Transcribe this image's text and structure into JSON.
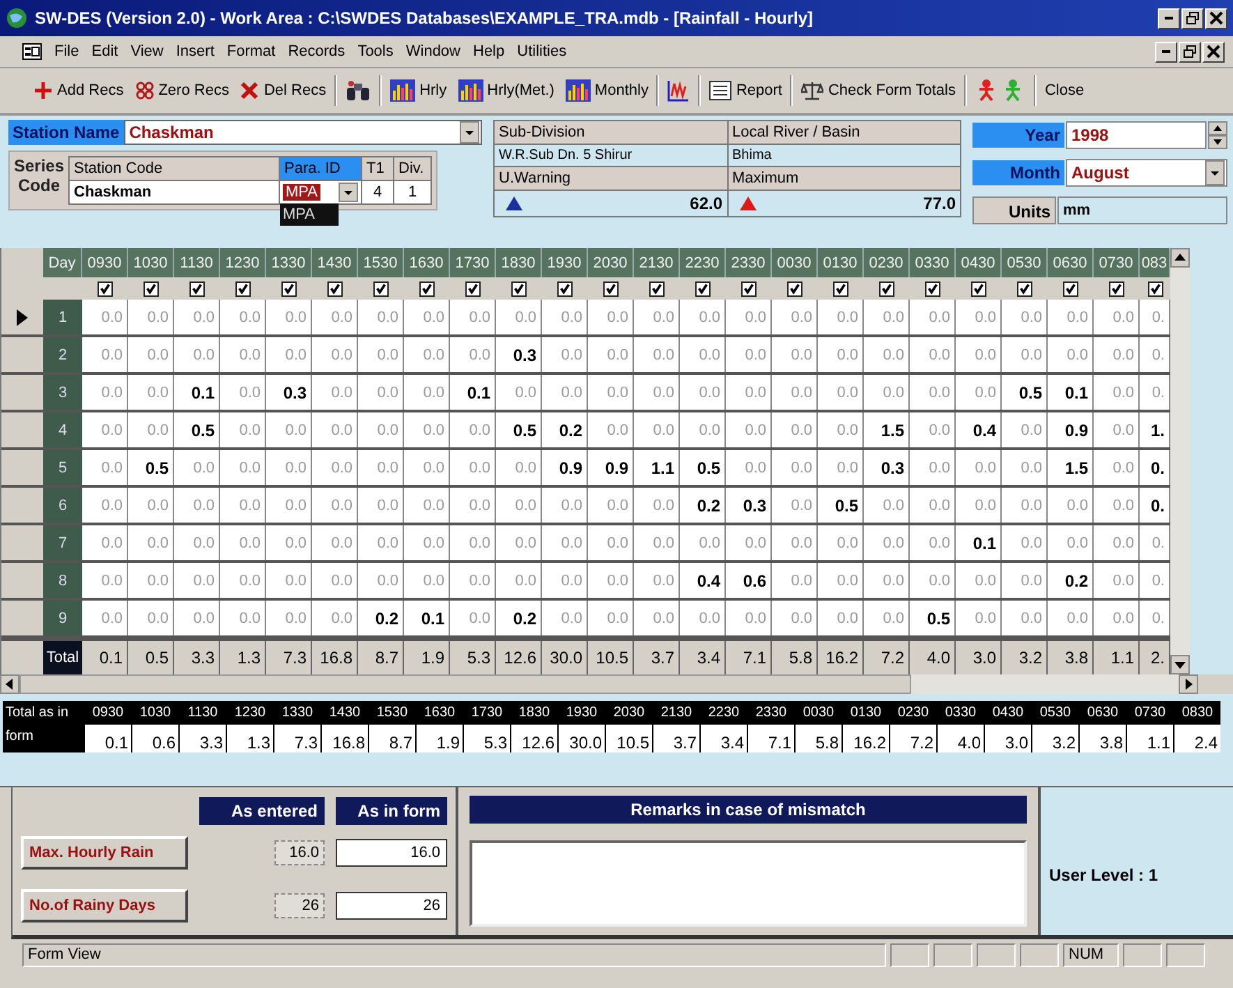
{
  "window": {
    "title": "SW-DES (Version 2.0) - Work Area : C:\\SWDES Databases\\EXAMPLE_TRA.mdb - [Rainfall - Hourly]"
  },
  "menu": [
    "File",
    "Edit",
    "View",
    "Insert",
    "Format",
    "Records",
    "Tools",
    "Window",
    "Help",
    "Utilities"
  ],
  "toolbar": [
    {
      "kind": "add",
      "label": "Add Recs"
    },
    {
      "kind": "zero",
      "label": "Zero Recs"
    },
    {
      "kind": "delete",
      "label": "Del Recs"
    },
    {
      "kind": "separator"
    },
    {
      "kind": "find"
    },
    {
      "kind": "separator"
    },
    {
      "kind": "chart",
      "label": "Hrly"
    },
    {
      "kind": "chart",
      "label": "Hrly(Met.)"
    },
    {
      "kind": "chart",
      "label": "Monthly"
    },
    {
      "kind": "separator"
    },
    {
      "kind": "graph"
    },
    {
      "kind": "separator"
    },
    {
      "kind": "report",
      "label": "Report"
    },
    {
      "kind": "separator"
    },
    {
      "kind": "scale",
      "label": "Check Form Totals"
    },
    {
      "kind": "separator"
    },
    {
      "kind": "figures"
    },
    {
      "kind": "separator"
    },
    {
      "kind": "close",
      "label": "Close"
    }
  ],
  "station": {
    "label": "Station Name",
    "value": "Chaskman"
  },
  "series_code": {
    "label": "Series Code",
    "columns": [
      "Station Code",
      "Para. ID",
      "T1",
      "Div."
    ],
    "station_code": "Chaskman",
    "para_id": "MPA",
    "t1": "4",
    "div": "1",
    "para_id_options": [
      "MPA"
    ]
  },
  "info": {
    "sub_division_label": "Sub-Division",
    "sub_division": "W.R.Sub Dn. 5 Shirur",
    "river_label": "Local River / Basin",
    "river": "Bhima",
    "warning_label": "U.Warning",
    "warning": "62.0",
    "maximum_label": "Maximum",
    "maximum": "77.0"
  },
  "year": {
    "label": "Year",
    "value": "1998"
  },
  "month": {
    "label": "Month",
    "value": "August"
  },
  "units": {
    "label": "Units",
    "value": "mm"
  },
  "grid": {
    "corner": "Day",
    "columns": [
      {
        "label": "0930",
        "checked": true
      },
      {
        "label": "1030",
        "checked": true
      },
      {
        "label": "1130",
        "checked": true
      },
      {
        "label": "1230",
        "checked": true
      },
      {
        "label": "1330",
        "checked": true
      },
      {
        "label": "1430",
        "checked": true
      },
      {
        "label": "1530",
        "checked": true
      },
      {
        "label": "1630",
        "checked": true
      },
      {
        "label": "1730",
        "checked": true
      },
      {
        "label": "1830",
        "checked": true
      },
      {
        "label": "1930",
        "checked": true
      },
      {
        "label": "2030",
        "checked": true
      },
      {
        "label": "2130",
        "checked": true
      },
      {
        "label": "2230",
        "checked": true
      },
      {
        "label": "2330",
        "checked": true
      },
      {
        "label": "0030",
        "checked": true
      },
      {
        "label": "0130",
        "checked": true
      },
      {
        "label": "0230",
        "checked": true
      },
      {
        "label": "0330",
        "checked": true
      },
      {
        "label": "0430",
        "checked": true
      },
      {
        "label": "0530",
        "checked": true
      },
      {
        "label": "0630",
        "checked": true
      },
      {
        "label": "0730",
        "checked": true
      },
      {
        "label": "083",
        "checked": true
      }
    ],
    "rows": [
      {
        "day": "1",
        "selected": true,
        "cells": [
          {
            "v": "0.0",
            "bold": false
          },
          {
            "v": "0.0",
            "bold": false
          },
          {
            "v": "0.0",
            "bold": false
          },
          {
            "v": "0.0",
            "bold": false
          },
          {
            "v": "0.0",
            "bold": false
          },
          {
            "v": "0.0",
            "bold": false
          },
          {
            "v": "0.0",
            "bold": false
          },
          {
            "v": "0.0",
            "bold": false
          },
          {
            "v": "0.0",
            "bold": false
          },
          {
            "v": "0.0",
            "bold": false
          },
          {
            "v": "0.0",
            "bold": false
          },
          {
            "v": "0.0",
            "bold": false
          },
          {
            "v": "0.0",
            "bold": false
          },
          {
            "v": "0.0",
            "bold": false
          },
          {
            "v": "0.0",
            "bold": false
          },
          {
            "v": "0.0",
            "bold": false
          },
          {
            "v": "0.0",
            "bold": false
          },
          {
            "v": "0.0",
            "bold": false
          },
          {
            "v": "0.0",
            "bold": false
          },
          {
            "v": "0.0",
            "bold": false
          },
          {
            "v": "0.0",
            "bold": false
          },
          {
            "v": "0.0",
            "bold": false
          },
          {
            "v": "0.0",
            "bold": false
          },
          {
            "v": "0.",
            "bold": false
          }
        ]
      },
      {
        "day": "2",
        "selected": false,
        "cells": [
          {
            "v": "0.0",
            "bold": false
          },
          {
            "v": "0.0",
            "bold": false
          },
          {
            "v": "0.0",
            "bold": false
          },
          {
            "v": "0.0",
            "bold": false
          },
          {
            "v": "0.0",
            "bold": false
          },
          {
            "v": "0.0",
            "bold": false
          },
          {
            "v": "0.0",
            "bold": false
          },
          {
            "v": "0.0",
            "bold": false
          },
          {
            "v": "0.0",
            "bold": false
          },
          {
            "v": "0.3",
            "bold": true
          },
          {
            "v": "0.0",
            "bold": false
          },
          {
            "v": "0.0",
            "bold": false
          },
          {
            "v": "0.0",
            "bold": false
          },
          {
            "v": "0.0",
            "bold": false
          },
          {
            "v": "0.0",
            "bold": false
          },
          {
            "v": "0.0",
            "bold": false
          },
          {
            "v": "0.0",
            "bold": false
          },
          {
            "v": "0.0",
            "bold": false
          },
          {
            "v": "0.0",
            "bold": false
          },
          {
            "v": "0.0",
            "bold": false
          },
          {
            "v": "0.0",
            "bold": false
          },
          {
            "v": "0.0",
            "bold": false
          },
          {
            "v": "0.0",
            "bold": false
          },
          {
            "v": "0.",
            "bold": false
          }
        ]
      },
      {
        "day": "3",
        "selected": false,
        "cells": [
          {
            "v": "0.0",
            "bold": false
          },
          {
            "v": "0.0",
            "bold": false
          },
          {
            "v": "0.1",
            "bold": true
          },
          {
            "v": "0.0",
            "bold": false
          },
          {
            "v": "0.3",
            "bold": true
          },
          {
            "v": "0.0",
            "bold": false
          },
          {
            "v": "0.0",
            "bold": false
          },
          {
            "v": "0.0",
            "bold": false
          },
          {
            "v": "0.1",
            "bold": true
          },
          {
            "v": "0.0",
            "bold": false
          },
          {
            "v": "0.0",
            "bold": false
          },
          {
            "v": "0.0",
            "bold": false
          },
          {
            "v": "0.0",
            "bold": false
          },
          {
            "v": "0.0",
            "bold": false
          },
          {
            "v": "0.0",
            "bold": false
          },
          {
            "v": "0.0",
            "bold": false
          },
          {
            "v": "0.0",
            "bold": false
          },
          {
            "v": "0.0",
            "bold": false
          },
          {
            "v": "0.0",
            "bold": false
          },
          {
            "v": "0.0",
            "bold": false
          },
          {
            "v": "0.5",
            "bold": true
          },
          {
            "v": "0.1",
            "bold": true
          },
          {
            "v": "0.0",
            "bold": false
          },
          {
            "v": "0.",
            "bold": false
          }
        ]
      },
      {
        "day": "4",
        "selected": false,
        "cells": [
          {
            "v": "0.0",
            "bold": false
          },
          {
            "v": "0.0",
            "bold": false
          },
          {
            "v": "0.5",
            "bold": true
          },
          {
            "v": "0.0",
            "bold": false
          },
          {
            "v": "0.0",
            "bold": false
          },
          {
            "v": "0.0",
            "bold": false
          },
          {
            "v": "0.0",
            "bold": false
          },
          {
            "v": "0.0",
            "bold": false
          },
          {
            "v": "0.0",
            "bold": false
          },
          {
            "v": "0.5",
            "bold": true
          },
          {
            "v": "0.2",
            "bold": true
          },
          {
            "v": "0.0",
            "bold": false
          },
          {
            "v": "0.0",
            "bold": false
          },
          {
            "v": "0.0",
            "bold": false
          },
          {
            "v": "0.0",
            "bold": false
          },
          {
            "v": "0.0",
            "bold": false
          },
          {
            "v": "0.0",
            "bold": false
          },
          {
            "v": "1.5",
            "bold": true
          },
          {
            "v": "0.0",
            "bold": false
          },
          {
            "v": "0.4",
            "bold": true
          },
          {
            "v": "0.0",
            "bold": false
          },
          {
            "v": "0.9",
            "bold": true
          },
          {
            "v": "0.0",
            "bold": false
          },
          {
            "v": "1.",
            "bold": true
          }
        ]
      },
      {
        "day": "5",
        "selected": false,
        "cells": [
          {
            "v": "0.0",
            "bold": false
          },
          {
            "v": "0.5",
            "bold": true
          },
          {
            "v": "0.0",
            "bold": false
          },
          {
            "v": "0.0",
            "bold": false
          },
          {
            "v": "0.0",
            "bold": false
          },
          {
            "v": "0.0",
            "bold": false
          },
          {
            "v": "0.0",
            "bold": false
          },
          {
            "v": "0.0",
            "bold": false
          },
          {
            "v": "0.0",
            "bold": false
          },
          {
            "v": "0.0",
            "bold": false
          },
          {
            "v": "0.9",
            "bold": true
          },
          {
            "v": "0.9",
            "bold": true
          },
          {
            "v": "1.1",
            "bold": true
          },
          {
            "v": "0.5",
            "bold": true
          },
          {
            "v": "0.0",
            "bold": false
          },
          {
            "v": "0.0",
            "bold": false
          },
          {
            "v": "0.0",
            "bold": false
          },
          {
            "v": "0.3",
            "bold": true
          },
          {
            "v": "0.0",
            "bold": false
          },
          {
            "v": "0.0",
            "bold": false
          },
          {
            "v": "0.0",
            "bold": false
          },
          {
            "v": "1.5",
            "bold": true
          },
          {
            "v": "0.0",
            "bold": false
          },
          {
            "v": "0.",
            "bold": true
          }
        ]
      },
      {
        "day": "6",
        "selected": false,
        "cells": [
          {
            "v": "0.0",
            "bold": false
          },
          {
            "v": "0.0",
            "bold": false
          },
          {
            "v": "0.0",
            "bold": false
          },
          {
            "v": "0.0",
            "bold": false
          },
          {
            "v": "0.0",
            "bold": false
          },
          {
            "v": "0.0",
            "bold": false
          },
          {
            "v": "0.0",
            "bold": false
          },
          {
            "v": "0.0",
            "bold": false
          },
          {
            "v": "0.0",
            "bold": false
          },
          {
            "v": "0.0",
            "bold": false
          },
          {
            "v": "0.0",
            "bold": false
          },
          {
            "v": "0.0",
            "bold": false
          },
          {
            "v": "0.0",
            "bold": false
          },
          {
            "v": "0.2",
            "bold": true
          },
          {
            "v": "0.3",
            "bold": true
          },
          {
            "v": "0.0",
            "bold": false
          },
          {
            "v": "0.5",
            "bold": true
          },
          {
            "v": "0.0",
            "bold": false
          },
          {
            "v": "0.0",
            "bold": false
          },
          {
            "v": "0.0",
            "bold": false
          },
          {
            "v": "0.0",
            "bold": false
          },
          {
            "v": "0.0",
            "bold": false
          },
          {
            "v": "0.0",
            "bold": false
          },
          {
            "v": "0.",
            "bold": true
          }
        ]
      },
      {
        "day": "7",
        "selected": false,
        "cells": [
          {
            "v": "0.0",
            "bold": false
          },
          {
            "v": "0.0",
            "bold": false
          },
          {
            "v": "0.0",
            "bold": false
          },
          {
            "v": "0.0",
            "bold": false
          },
          {
            "v": "0.0",
            "bold": false
          },
          {
            "v": "0.0",
            "bold": false
          },
          {
            "v": "0.0",
            "bold": false
          },
          {
            "v": "0.0",
            "bold": false
          },
          {
            "v": "0.0",
            "bold": false
          },
          {
            "v": "0.0",
            "bold": false
          },
          {
            "v": "0.0",
            "bold": false
          },
          {
            "v": "0.0",
            "bold": false
          },
          {
            "v": "0.0",
            "bold": false
          },
          {
            "v": "0.0",
            "bold": false
          },
          {
            "v": "0.0",
            "bold": false
          },
          {
            "v": "0.0",
            "bold": false
          },
          {
            "v": "0.0",
            "bold": false
          },
          {
            "v": "0.0",
            "bold": false
          },
          {
            "v": "0.0",
            "bold": false
          },
          {
            "v": "0.1",
            "bold": true
          },
          {
            "v": "0.0",
            "bold": false
          },
          {
            "v": "0.0",
            "bold": false
          },
          {
            "v": "0.0",
            "bold": false
          },
          {
            "v": "0.",
            "bold": false
          }
        ]
      },
      {
        "day": "8",
        "selected": false,
        "cells": [
          {
            "v": "0.0",
            "bold": false
          },
          {
            "v": "0.0",
            "bold": false
          },
          {
            "v": "0.0",
            "bold": false
          },
          {
            "v": "0.0",
            "bold": false
          },
          {
            "v": "0.0",
            "bold": false
          },
          {
            "v": "0.0",
            "bold": false
          },
          {
            "v": "0.0",
            "bold": false
          },
          {
            "v": "0.0",
            "bold": false
          },
          {
            "v": "0.0",
            "bold": false
          },
          {
            "v": "0.0",
            "bold": false
          },
          {
            "v": "0.0",
            "bold": false
          },
          {
            "v": "0.0",
            "bold": false
          },
          {
            "v": "0.0",
            "bold": false
          },
          {
            "v": "0.4",
            "bold": true
          },
          {
            "v": "0.6",
            "bold": true
          },
          {
            "v": "0.0",
            "bold": false
          },
          {
            "v": "0.0",
            "bold": false
          },
          {
            "v": "0.0",
            "bold": false
          },
          {
            "v": "0.0",
            "bold": false
          },
          {
            "v": "0.0",
            "bold": false
          },
          {
            "v": "0.0",
            "bold": false
          },
          {
            "v": "0.2",
            "bold": true
          },
          {
            "v": "0.0",
            "bold": false
          },
          {
            "v": "0.",
            "bold": false
          }
        ]
      },
      {
        "day": "9",
        "selected": false,
        "cells": [
          {
            "v": "0.0",
            "bold": false
          },
          {
            "v": "0.0",
            "bold": false
          },
          {
            "v": "0.0",
            "bold": false
          },
          {
            "v": "0.0",
            "bold": false
          },
          {
            "v": "0.0",
            "bold": false
          },
          {
            "v": "0.0",
            "bold": false
          },
          {
            "v": "0.2",
            "bold": true
          },
          {
            "v": "0.1",
            "bold": true
          },
          {
            "v": "0.0",
            "bold": false
          },
          {
            "v": "0.2",
            "bold": true
          },
          {
            "v": "0.0",
            "bold": false
          },
          {
            "v": "0.0",
            "bold": false
          },
          {
            "v": "0.0",
            "bold": false
          },
          {
            "v": "0.0",
            "bold": false
          },
          {
            "v": "0.0",
            "bold": false
          },
          {
            "v": "0.0",
            "bold": false
          },
          {
            "v": "0.0",
            "bold": false
          },
          {
            "v": "0.0",
            "bold": false
          },
          {
            "v": "0.5",
            "bold": true
          },
          {
            "v": "0.0",
            "bold": false
          },
          {
            "v": "0.0",
            "bold": false
          },
          {
            "v": "0.0",
            "bold": false
          },
          {
            "v": "0.0",
            "bold": false
          },
          {
            "v": "0.",
            "bold": false
          }
        ]
      }
    ],
    "total": {
      "label": "Total",
      "values": [
        "0.1",
        "0.5",
        "3.3",
        "1.3",
        "7.3",
        "16.8",
        "8.7",
        "1.9",
        "5.3",
        "12.6",
        "30.0",
        "10.5",
        "3.7",
        "3.4",
        "7.1",
        "5.8",
        "16.2",
        "7.2",
        "4.0",
        "3.0",
        "3.2",
        "3.8",
        "1.1",
        "2."
      ]
    }
  },
  "form_totals": {
    "label": "Total as in form",
    "columns": [
      "0930",
      "1030",
      "1130",
      "1230",
      "1330",
      "1430",
      "1530",
      "1630",
      "1730",
      "1830",
      "1930",
      "2030",
      "2130",
      "2230",
      "2330",
      "0030",
      "0130",
      "0230",
      "0330",
      "0430",
      "0530",
      "0630",
      "0730",
      "0830"
    ],
    "values": [
      "0.1",
      "0.6",
      "3.3",
      "1.3",
      "7.3",
      "16.8",
      "8.7",
      "1.9",
      "5.3",
      "12.6",
      "30.0",
      "10.5",
      "3.7",
      "3.4",
      "7.1",
      "5.8",
      "16.2",
      "7.2",
      "4.0",
      "3.0",
      "3.2",
      "3.8",
      "1.1",
      "2.4"
    ]
  },
  "summary": {
    "as_entered": "As entered",
    "as_in_form": "As in form",
    "remarks": "Remarks in case of mismatch",
    "rows": [
      {
        "label": "Max. Hourly Rain",
        "entered": "16.0",
        "form": "16.0"
      },
      {
        "label": "No.of Rainy Days",
        "entered": "26",
        "form": "26"
      }
    ],
    "user_level": "User Level : 1"
  },
  "status_bar": {
    "text": "Form View",
    "indicator": "NUM"
  }
}
